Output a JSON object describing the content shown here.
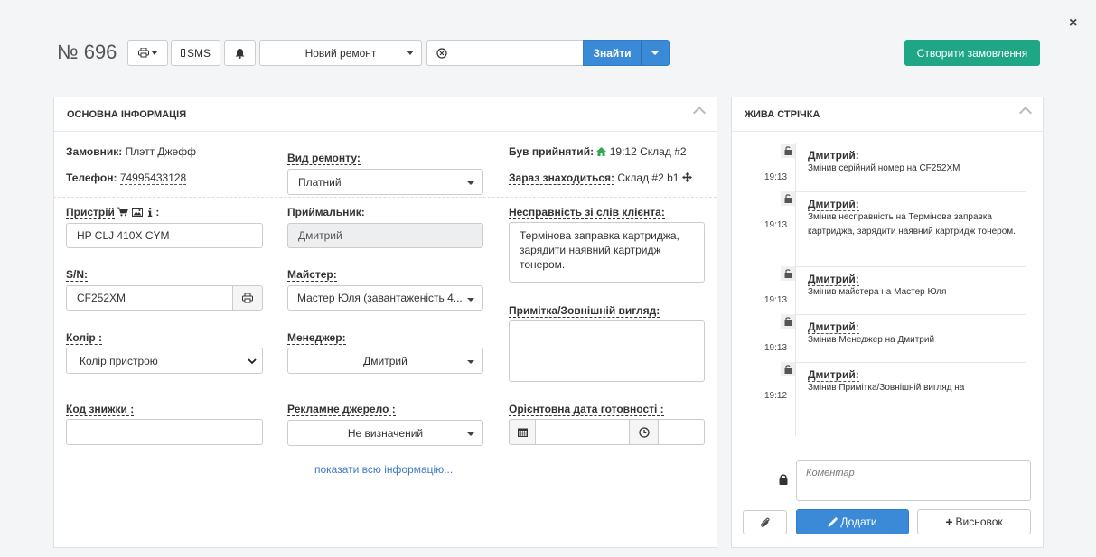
{
  "header": {
    "order_number": "№ 696",
    "sms_label": "SMS",
    "status_value": "Новий ремонт",
    "find_label": "Знайти",
    "search_value": "",
    "create_order_label": "Створити замовлення"
  },
  "main_panel": {
    "title": "ОСНОВНА ІНФОРМАЦІЯ",
    "customer_label": "Замовник:",
    "customer_value": "Плэтт Джефф",
    "phone_label": "Телефон:",
    "phone_value": "74995433128",
    "repair_type_label": "Вид ремонту:",
    "repair_type_value": "Платний",
    "accepted_label": "Був прийнятий:",
    "accepted_value": "19:12 Склад #2",
    "location_label": "Зараз знаходиться:",
    "location_value": "Склад #2 b1",
    "device_label": "Пристрій",
    "device_label_suffix": ":",
    "device_value": "HP CLJ 410X CYM",
    "receiver_label": "Приймальник:",
    "receiver_value": "Дмитрий",
    "fault_label": "Несправність зі слів клієнта:",
    "fault_value": "Термінова заправка картриджа, зарядити наявний картридж тонером.",
    "sn_label": "S/N:",
    "sn_value": "CF252XM",
    "master_label": "Майстер:",
    "master_value": "Мастер Юля (завантаженість 4...",
    "note_label": "Примітка/Зовнішній вигляд:",
    "note_value": "",
    "color_label": "Колір :",
    "color_value": "Колір пристрою",
    "manager_label": "Менеджер:",
    "manager_value": "Дмитрий",
    "discount_label": "Код знижки :",
    "discount_value": "",
    "ad_source_label": "Рекламне джерело :",
    "ad_source_value": "Не визначений",
    "ready_date_label": "Орієнтовна дата готовності :",
    "ready_date_value": "",
    "ready_time_value": "",
    "show_all_link": "показати всю інформацію..."
  },
  "feed_panel": {
    "title": "ЖИВА СТРІЧКА",
    "items": [
      {
        "time": "19:13",
        "author": "Дмитрий:",
        "text": "Змінив серійний номер на CF252XM"
      },
      {
        "time": "19:13",
        "author": "Дмитрий:",
        "text": "Змінив несправність на Термінова заправка картриджа, зарядити наявний картридж тонером."
      },
      {
        "time": "19:13",
        "author": "Дмитрий:",
        "text": "Змінив майстера на Мастер Юля"
      },
      {
        "time": "19:13",
        "author": "Дмитрий:",
        "text": "Змінив Менеджер на Дмитрий"
      },
      {
        "time": "19:12",
        "author": "Дмитрий:",
        "text": "Змінив Примітка/Зовнішній вигляд на"
      }
    ],
    "comment_placeholder": "Коментар",
    "add_label": "Додати",
    "conclusion_label": "Висновок"
  },
  "colors": {
    "primary_blue": "#3a8ad8",
    "create_green": "#1fa785",
    "home_icon_green": "#2fa84f"
  }
}
